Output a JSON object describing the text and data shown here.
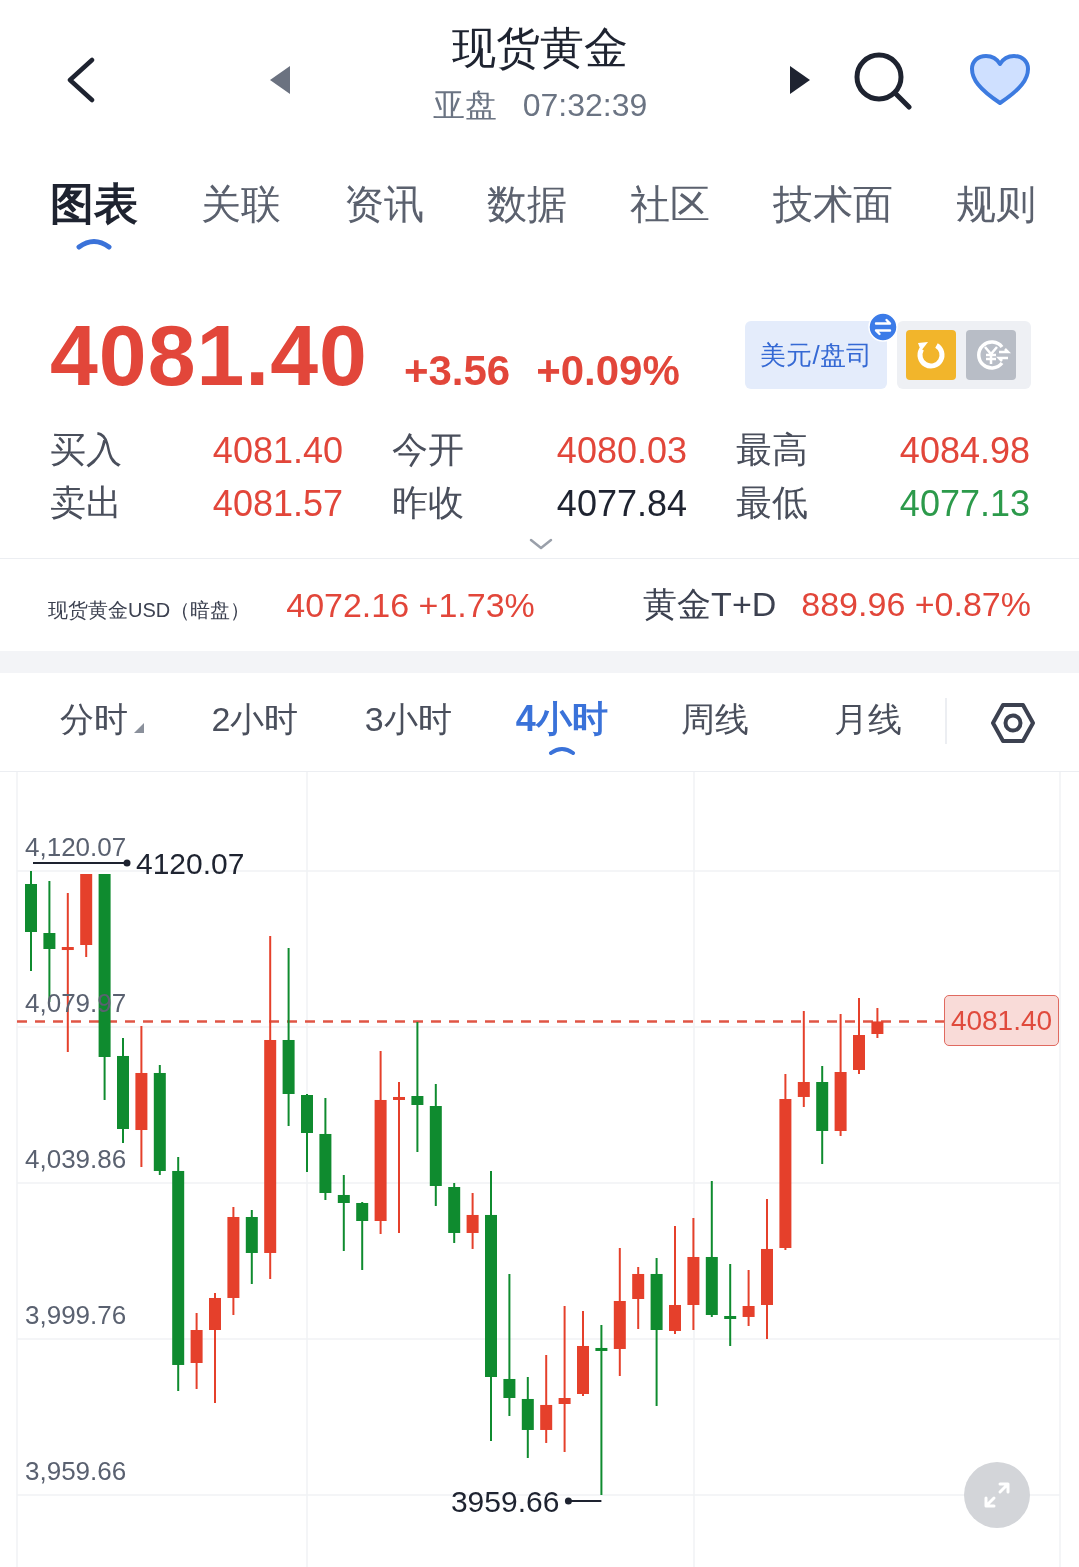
{
  "header": {
    "title": "现货黄金",
    "session": "亚盘",
    "time": "07:32:39",
    "favorite": true
  },
  "tabs": [
    {
      "label": "图表",
      "selected": true
    },
    {
      "label": "关联",
      "selected": false
    },
    {
      "label": "资讯",
      "selected": false
    },
    {
      "label": "数据",
      "selected": false
    },
    {
      "label": "社区",
      "selected": false
    },
    {
      "label": "技术面",
      "selected": false
    },
    {
      "label": "规则",
      "selected": false
    }
  ],
  "quote": {
    "price": "4081.40",
    "change": "+3.56",
    "change_percent": "+0.09%",
    "up": true,
    "unit_button": "美元/盘司"
  },
  "toggles": [
    {
      "kind": "refresh",
      "on": true
    },
    {
      "kind": "currency",
      "on": false
    }
  ],
  "stats": [
    {
      "label": "买入",
      "value": "4081.40",
      "color": "#e2463a"
    },
    {
      "label": "今开",
      "value": "4080.03",
      "color": "#e2463a"
    },
    {
      "label": "最高",
      "value": "4084.98",
      "color": "#e2463a"
    },
    {
      "label": "卖出",
      "value": "4081.57",
      "color": "#e2463a"
    },
    {
      "label": "昨收",
      "value": "4077.84",
      "color": "#1e2330"
    },
    {
      "label": "最低",
      "value": "4077.13",
      "color": "#2c9a4b"
    }
  ],
  "related": [
    {
      "name": "现货黄金USD（暗盘）",
      "quote": "4072.16 +1.73%",
      "up": true
    },
    {
      "name": "黄金T+D",
      "quote": "889.96 +0.87%",
      "up": true
    }
  ],
  "periods": [
    {
      "label": "分时",
      "selected": false,
      "dropdown": true
    },
    {
      "label": "2小时",
      "selected": false,
      "dropdown": false
    },
    {
      "label": "3小时",
      "selected": false,
      "dropdown": false
    },
    {
      "label": "4小时",
      "selected": true,
      "dropdown": false
    },
    {
      "label": "周线",
      "selected": false,
      "dropdown": false
    },
    {
      "label": "月线",
      "selected": false,
      "dropdown": false
    }
  ],
  "chart": {
    "high_label": "4120.07",
    "low_label": "3959.66",
    "last_price": "4081.40",
    "chart_data": {
      "type": "candlestick",
      "grid": true,
      "ohlc": [
        [
          4116.73,
          4120.07,
          4094.36,
          4104.39
        ],
        [
          4104.13,
          4117.5,
          4086.4,
          4100.02
        ],
        [
          4100.02,
          4114.42,
          4073.54,
          4100.53
        ],
        [
          4101.05,
          4119.3,
          4097.96,
          4119.3
        ],
        [
          4119.3,
          4119.3,
          4061.21,
          4072.26
        ],
        [
          4072.52,
          4077.14,
          4050.15,
          4053.75
        ],
        [
          4053.49,
          4080.23,
          4043.98,
          4068.15
        ],
        [
          4068.15,
          4070.2,
          4041.93,
          4042.96
        ],
        [
          4042.96,
          4046.55,
          3986.4,
          3993.09
        ],
        [
          3993.6,
          4006.45,
          3986.92,
          4002.08
        ],
        [
          4002.08,
          4011.6,
          3983.32,
          4010.31
        ],
        [
          4010.31,
          4033.7,
          4005.94,
          4031.13
        ],
        [
          4031.13,
          4032.93,
          4013.91,
          4021.88
        ],
        [
          4021.88,
          4103.36,
          4015.19,
          4076.63
        ],
        [
          4076.63,
          4100.28,
          4054.52,
          4062.75
        ],
        [
          4062.49,
          4062.75,
          4042.7,
          4052.72
        ],
        [
          4052.47,
          4061.72,
          4035.5,
          4037.3
        ],
        [
          4036.79,
          4041.93,
          4022.39,
          4034.73
        ],
        [
          4034.73,
          4034.99,
          4017.51,
          4030.1
        ],
        [
          4030.1,
          4073.8,
          4026.76,
          4061.21
        ],
        [
          4061.46,
          4065.83,
          4027.02,
          4061.98
        ],
        [
          4062.23,
          4081.26,
          4047.84,
          4059.92
        ],
        [
          4059.66,
          4065.32,
          4033.96,
          4039.1
        ],
        [
          4038.84,
          4039.87,
          4024.45,
          4027.02
        ],
        [
          4027.02,
          4037.3,
          4022.91,
          4031.65
        ],
        [
          4031.65,
          4042.96,
          3973.55,
          3990.0
        ],
        [
          3989.49,
          4016.48,
          3979.98,
          3984.6
        ],
        [
          3984.35,
          3990.0,
          3969.18,
          3976.38
        ],
        [
          3976.38,
          3995.66,
          3973.04,
          3982.81
        ],
        [
          3983.06,
          4008.25,
          3970.72,
          3984.6
        ],
        [
          3985.63,
          4006.97,
          3985.12,
          3997.97
        ],
        [
          3997.46,
          4003.37,
          3959.66,
          3996.94
        ],
        [
          3997.2,
          4023.16,
          3990.26,
          4009.54
        ],
        [
          4010.05,
          4018.28,
          4002.34,
          4016.48
        ],
        [
          4016.48,
          4020.59,
          3982.55,
          4002.08
        ],
        [
          4001.83,
          4028.82,
          4001.06,
          4008.51
        ],
        [
          4008.51,
          4030.87,
          4002.08,
          4020.85
        ],
        [
          4020.85,
          4040.38,
          4005.43,
          4005.94
        ],
        [
          4005.68,
          4019.05,
          3997.97,
          4005.17
        ],
        [
          4005.43,
          4017.51,
          4003.11,
          4008.25
        ],
        [
          4008.51,
          4035.76,
          3999.77,
          4022.91
        ],
        [
          4023.16,
          4067.89,
          4022.65,
          4061.46
        ],
        [
          4061.98,
          4084.08,
          4059.41,
          4065.83
        ],
        [
          4065.83,
          4069.95,
          4044.75,
          4053.24
        ],
        [
          4053.24,
          4083.31,
          4051.95,
          4068.4
        ],
        [
          4068.92,
          4087.42,
          4067.89,
          4077.91
        ],
        [
          4078.17,
          4084.85,
          4077.14,
          4081.4
        ]
      ],
      "ref_lines": [
        {
          "axis": "y",
          "value": 4081.4
        }
      ],
      "ylim": [
        3940.9,
        4145.52
      ],
      "yticks": [
        {
          "value": 4120.07,
          "label": "4,120.07"
        },
        {
          "value": 4079.97,
          "label": "4,079.97"
        },
        {
          "value": 4039.86,
          "label": "4,039.86"
        },
        {
          "value": 3999.76,
          "label": "3,999.76"
        },
        {
          "value": 3959.66,
          "label": "3,959.66"
        }
      ]
    }
  }
}
